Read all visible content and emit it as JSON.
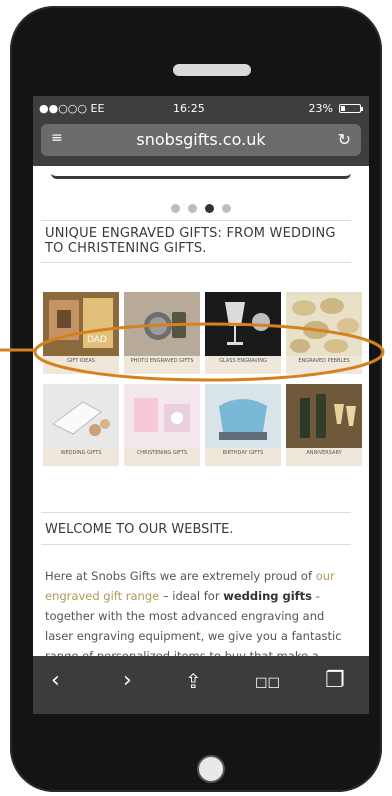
{
  "status": {
    "carrier": "●●○○○ EE",
    "time": "16:25",
    "battery_text": "23%",
    "battery_level": 0.23
  },
  "address_bar": {
    "url": "snobsgifts.co.uk"
  },
  "carousel": {
    "dots": 4,
    "active_index": 2
  },
  "section1": {
    "heading": "UNIQUE ENGRAVED GIFTS: FROM WEDDING TO CHRISTENING GIFTS."
  },
  "gifts": [
    {
      "caption": "GIFT IDEAS"
    },
    {
      "caption": "PHOTO ENGRAVED GIFTS"
    },
    {
      "caption": "GLASS ENGRAVING"
    },
    {
      "caption": "ENGRAVED PEBBLES"
    },
    {
      "caption": "WEDDING GIFTS"
    },
    {
      "caption": "CHRISTENING GIFTS"
    },
    {
      "caption": "BIRTHDAY GIFTS"
    },
    {
      "caption": "ANNIVERSARY"
    }
  ],
  "welcome": {
    "heading": "WELCOME TO OUR WEBSITE.",
    "text_1": "Here at Snobs Gifts we are extremely proud of ",
    "link": "our engraved gift range",
    "text_2": " – ideal for ",
    "bold": "wedding gifts",
    "text_3": " - together with the most advanced engraving and laser engraving equipment, we give you a fantastic range of personalized items to buy that make a unique present for that special occasion - be it a"
  },
  "toolbar": {
    "back": "‹",
    "forward": "›",
    "share": "⇪",
    "bookmarks": "☐☐",
    "tabs": "❐"
  },
  "colors": {
    "accent_link": "#b09a58",
    "oval": "#d6801f",
    "chrome": "#3c3c3c"
  }
}
